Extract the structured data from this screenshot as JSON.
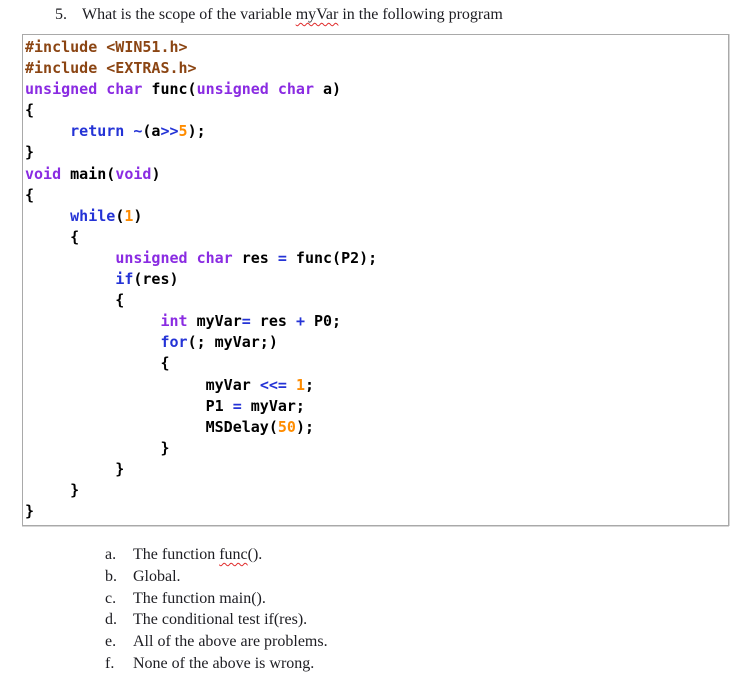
{
  "colors": {
    "preprocessor": "#8B4513",
    "type_keyword": "#8A2BE2",
    "control_keyword": "#2433D6",
    "operator": "#2433D6",
    "number": "#FF8C00",
    "code_text": "#000000",
    "squiggle": "#E02B2B",
    "box_border": "#A9A9A9"
  },
  "question": {
    "number": "5.",
    "parts": [
      [
        "plain",
        "What is the scope of the variable "
      ],
      [
        "wavy",
        "myVar"
      ],
      [
        "plain",
        " in the following program"
      ]
    ]
  },
  "code": {
    "lines": [
      [
        [
          "pp",
          "#include <WIN51.h>"
        ]
      ],
      [
        [
          "pp",
          "#include <EXTRAS.h>"
        ]
      ],
      [
        [
          "type",
          "unsigned char"
        ],
        [
          "plain",
          " func("
        ],
        [
          "type",
          "unsigned char"
        ],
        [
          "plain",
          " a)"
        ]
      ],
      [
        [
          "plain",
          "{"
        ]
      ],
      [
        [
          "plain",
          "     "
        ],
        [
          "kw",
          "return"
        ],
        [
          "plain",
          " "
        ],
        [
          "op",
          "~"
        ],
        [
          "plain",
          "(a"
        ],
        [
          "op",
          ">>"
        ],
        [
          "num",
          "5"
        ],
        [
          "plain",
          ");"
        ]
      ],
      [
        [
          "plain",
          "}"
        ]
      ],
      [
        [
          "type",
          "void"
        ],
        [
          "plain",
          " main("
        ],
        [
          "type",
          "void"
        ],
        [
          "plain",
          ")"
        ]
      ],
      [
        [
          "plain",
          "{"
        ]
      ],
      [
        [
          "plain",
          "     "
        ],
        [
          "kw",
          "while"
        ],
        [
          "plain",
          "("
        ],
        [
          "num",
          "1"
        ],
        [
          "plain",
          ")"
        ]
      ],
      [
        [
          "plain",
          "     {"
        ]
      ],
      [
        [
          "plain",
          "          "
        ],
        [
          "type",
          "unsigned char"
        ],
        [
          "plain",
          " res "
        ],
        [
          "op",
          "="
        ],
        [
          "plain",
          " func(P2);"
        ]
      ],
      [
        [
          "plain",
          "          "
        ],
        [
          "kw",
          "if"
        ],
        [
          "plain",
          "(res)"
        ]
      ],
      [
        [
          "plain",
          "          {"
        ]
      ],
      [
        [
          "plain",
          "               "
        ],
        [
          "type",
          "int"
        ],
        [
          "plain",
          " myVar"
        ],
        [
          "op",
          "="
        ],
        [
          "plain",
          " res "
        ],
        [
          "op",
          "+"
        ],
        [
          "plain",
          " P0;"
        ]
      ],
      [
        [
          "plain",
          "               "
        ],
        [
          "kw",
          "for"
        ],
        [
          "plain",
          "(; myVar;)"
        ]
      ],
      [
        [
          "plain",
          "               {"
        ]
      ],
      [
        [
          "plain",
          "                    myVar "
        ],
        [
          "op",
          "<<="
        ],
        [
          "plain",
          " "
        ],
        [
          "num",
          "1"
        ],
        [
          "plain",
          ";"
        ]
      ],
      [
        [
          "plain",
          "                    P1 "
        ],
        [
          "op",
          "="
        ],
        [
          "plain",
          " myVar;"
        ]
      ],
      [
        [
          "plain",
          "                    MSDelay("
        ],
        [
          "num",
          "50"
        ],
        [
          "plain",
          ");"
        ]
      ],
      [
        [
          "plain",
          "               }"
        ]
      ],
      [
        [
          "plain",
          "          }"
        ]
      ],
      [
        [
          "plain",
          "     }"
        ]
      ],
      [
        [
          "plain",
          "}"
        ]
      ]
    ]
  },
  "options": [
    {
      "letter": "a.",
      "parts": [
        [
          "plain",
          "The function "
        ],
        [
          "wavy",
          "func"
        ],
        [
          "plain",
          "()."
        ]
      ]
    },
    {
      "letter": "b.",
      "parts": [
        [
          "plain",
          "Global."
        ]
      ]
    },
    {
      "letter": "c.",
      "parts": [
        [
          "plain",
          "The function main()."
        ]
      ]
    },
    {
      "letter": "d.",
      "parts": [
        [
          "plain",
          "The conditional test if(res)."
        ]
      ]
    },
    {
      "letter": "e.",
      "parts": [
        [
          "plain",
          "All of the above are problems."
        ]
      ]
    },
    {
      "letter": "f.",
      "parts": [
        [
          "plain",
          "None of the above is wrong."
        ]
      ]
    }
  ]
}
